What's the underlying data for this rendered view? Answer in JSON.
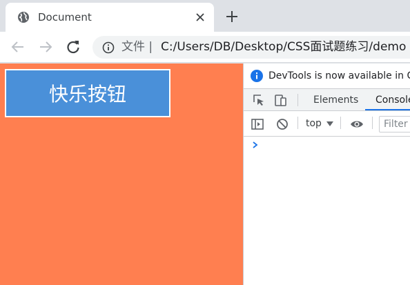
{
  "browser": {
    "tab_title": "Document",
    "url_label": "文件 |",
    "url": "C:/Users/DB/Desktop/CSS面试题练习/demo"
  },
  "page": {
    "button_label": "快乐按钮"
  },
  "devtools": {
    "info_text": "DevTools is now available in Ch",
    "tabs": [
      "Elements",
      "Console"
    ],
    "context": "top",
    "filter_placeholder": "Filter"
  },
  "colors": {
    "page_bg": "#ff7f50",
    "button_bg": "#4a90d9",
    "accent": "#1a73e8"
  }
}
